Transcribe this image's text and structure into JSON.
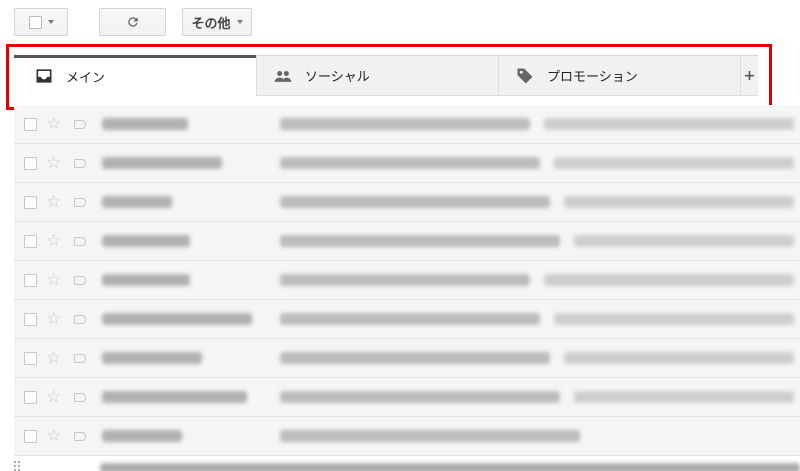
{
  "toolbar": {
    "refresh_glyph": "⟳",
    "more_label": "その他"
  },
  "tabs": [
    {
      "label": "メイン",
      "icon": "inbox-icon",
      "active": true
    },
    {
      "label": "ソーシャル",
      "icon": "people-icon",
      "active": false
    },
    {
      "label": "プロモーション",
      "icon": "tag-icon",
      "active": false
    }
  ],
  "add_tab_label": "+",
  "list": {
    "row_star": "☆"
  },
  "colors": {
    "highlight": "#e00000",
    "active_tab_bar": "#555555",
    "row_bg": "#f5f5f5"
  }
}
